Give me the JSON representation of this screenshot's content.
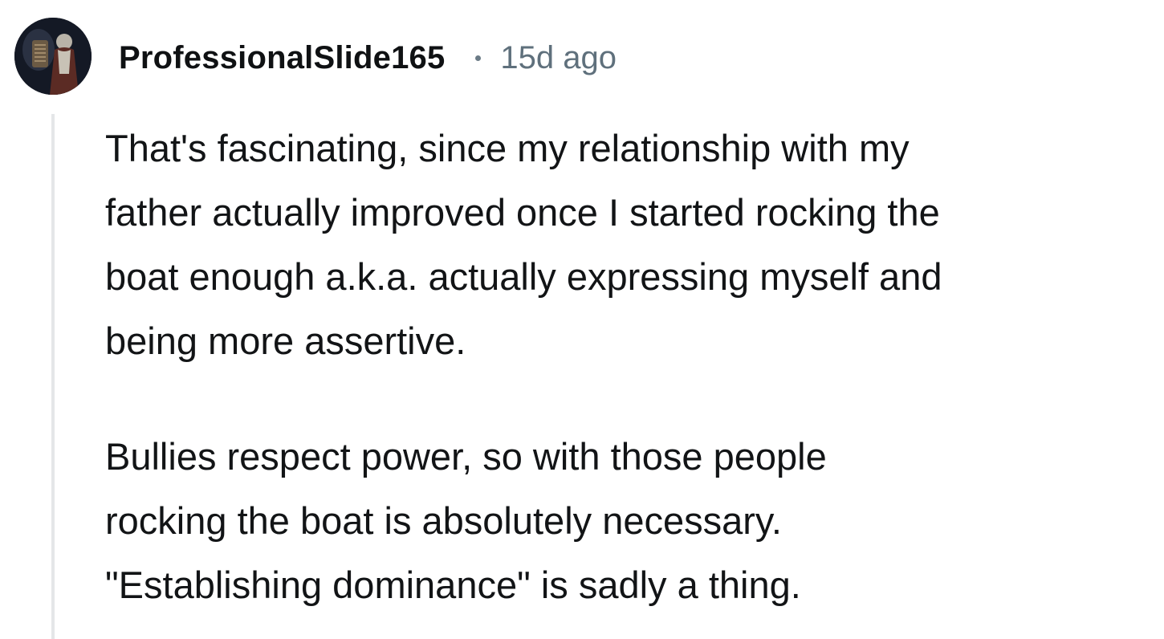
{
  "comment": {
    "author": {
      "username": "ProfessionalSlide165",
      "avatar_icon": "user-avatar-icon"
    },
    "separator": "•",
    "timestamp": "15d ago",
    "paragraphs": [
      {
        "lines": [
          "That's fascinating, since my relationship with my",
          "father actually improved once I started rocking the",
          "boat enough a.k.a. actually expressing myself and",
          "being more assertive."
        ]
      },
      {
        "lines": [
          "Bullies respect power, so with those people",
          "rocking the boat is absolutely necessary.",
          "\"Establishing dominance\" is sadly a thing."
        ]
      }
    ]
  },
  "colors": {
    "username": "#0f1113",
    "timestamp": "#5f707c",
    "body_text": "#121416",
    "thread_line": "#e4e6e8",
    "background": "#ffffff"
  }
}
